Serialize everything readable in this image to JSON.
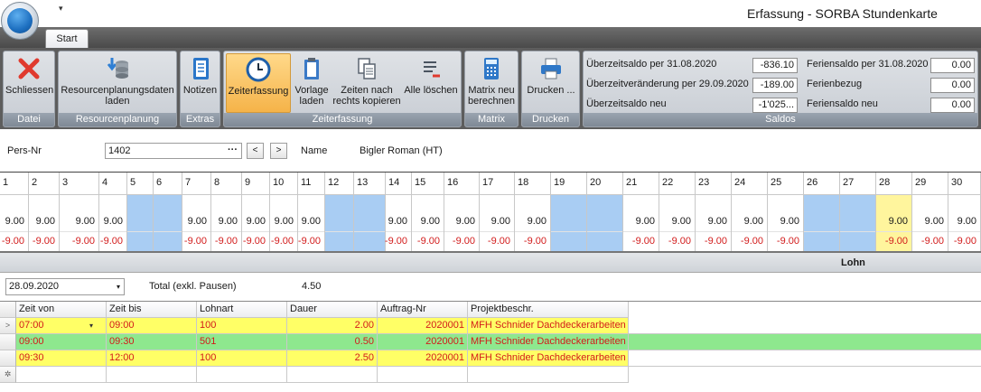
{
  "window": {
    "title": "Erfassung - SORBA Stundenkarte",
    "qat_glyph": "▾"
  },
  "tabs": [
    {
      "label": "Start"
    }
  ],
  "ribbon": {
    "groups": [
      {
        "label": "Datei",
        "buttons": [
          {
            "label": "Schliessen",
            "icon": "close-icon"
          }
        ]
      },
      {
        "label": "Resourcenplanung",
        "buttons": [
          {
            "label": "Resourcenplanungsdaten laden",
            "icon": "database-download-icon"
          }
        ]
      },
      {
        "label": "Extras",
        "buttons": [
          {
            "label": "Notizen",
            "icon": "notebook-icon"
          }
        ]
      },
      {
        "label": "Zeiterfassung",
        "buttons": [
          {
            "label": "Zeiterfassung",
            "icon": "clock-icon"
          },
          {
            "label": "Vorlage laden",
            "icon": "clipboard-icon"
          },
          {
            "label": "Zeiten nach rechts kopieren",
            "icon": "copy-icon"
          },
          {
            "label": "Alle löschen",
            "icon": "delete-list-icon"
          }
        ]
      },
      {
        "label": "Matrix",
        "buttons": [
          {
            "label": "Matrix neu berechnen",
            "icon": "calculator-icon"
          }
        ]
      },
      {
        "label": "Drucken",
        "buttons": [
          {
            "label": "Drucken ...",
            "icon": "printer-icon"
          }
        ]
      }
    ],
    "saldos": {
      "label": "Saldos",
      "rows": [
        {
          "label": "Überzeitsaldo per 31.08.2020",
          "value": "-836.10"
        },
        {
          "label": "Überzeitveränderung per 29.09.2020",
          "value": "-189.00"
        },
        {
          "label": "Überzeitsaldo neu",
          "value": "-1'025..."
        }
      ],
      "ferien": [
        {
          "label": "Feriensaldo per 31.08.2020",
          "value": "0.00"
        },
        {
          "label": "Ferienbezug",
          "value": "0.00"
        },
        {
          "label": "Feriensaldo neu",
          "value": "0.00"
        }
      ]
    }
  },
  "person": {
    "pers_nr_label": "Pers-Nr",
    "pers_nr_value": "1402",
    "lookup_glyph": "···",
    "prev_glyph": "<",
    "next_glyph": ">",
    "name_label": "Name",
    "name_value": "Bigler Roman (HT)"
  },
  "calendar": {
    "days": [
      {
        "day": "1",
        "soll": "9.00",
        "diff": "-9.00"
      },
      {
        "day": "2",
        "soll": "9.00",
        "diff": "-9.00"
      },
      {
        "day": "3",
        "soll": "9.00",
        "diff": "-9.00"
      },
      {
        "day": "4",
        "soll": "9.00",
        "diff": "-9.00"
      },
      {
        "day": "5",
        "soll": "",
        "diff": "",
        "weekend": true
      },
      {
        "day": "6",
        "soll": "",
        "diff": "",
        "weekend": true
      },
      {
        "day": "7",
        "soll": "9.00",
        "diff": "-9.00"
      },
      {
        "day": "8",
        "soll": "9.00",
        "diff": "-9.00"
      },
      {
        "day": "9",
        "soll": "9.00",
        "diff": "-9.00"
      },
      {
        "day": "10",
        "soll": "9.00",
        "diff": "-9.00"
      },
      {
        "day": "11",
        "soll": "9.00",
        "diff": "-9.00"
      },
      {
        "day": "12",
        "soll": "",
        "diff": "",
        "weekend": true
      },
      {
        "day": "13",
        "soll": "",
        "diff": "",
        "weekend": true
      },
      {
        "day": "14",
        "soll": "9.00",
        "diff": "-9.00"
      },
      {
        "day": "15",
        "soll": "9.00",
        "diff": "-9.00"
      },
      {
        "day": "16",
        "soll": "9.00",
        "diff": "-9.00"
      },
      {
        "day": "17",
        "soll": "9.00",
        "diff": "-9.00"
      },
      {
        "day": "18",
        "soll": "9.00",
        "diff": "-9.00"
      },
      {
        "day": "19",
        "soll": "",
        "diff": "",
        "weekend": true
      },
      {
        "day": "20",
        "soll": "",
        "diff": "",
        "weekend": true
      },
      {
        "day": "21",
        "soll": "9.00",
        "diff": "-9.00"
      },
      {
        "day": "22",
        "soll": "9.00",
        "diff": "-9.00"
      },
      {
        "day": "23",
        "soll": "9.00",
        "diff": "-9.00"
      },
      {
        "day": "24",
        "soll": "9.00",
        "diff": "-9.00"
      },
      {
        "day": "25",
        "soll": "9.00",
        "diff": "-9.00"
      },
      {
        "day": "26",
        "soll": "",
        "diff": "",
        "weekend": true
      },
      {
        "day": "27",
        "soll": "",
        "diff": "",
        "weekend": true
      },
      {
        "day": "28",
        "soll": "9.00",
        "diff": "-9.00",
        "today": true
      },
      {
        "day": "29",
        "soll": "9.00",
        "diff": "-9.00"
      },
      {
        "day": "30",
        "soll": "9.00",
        "diff": "-9.00"
      }
    ]
  },
  "lohn": {
    "label": "Lohn"
  },
  "entry": {
    "date": "28.09.2020",
    "date_arrow": "▾",
    "total_label": "Total (exkl. Pausen)",
    "total_value": "4.50"
  },
  "grid": {
    "columns": [
      "Zeit von",
      "Zeit bis",
      "Lohnart",
      "Dauer",
      "Auftrag-Nr",
      "Projektbeschr."
    ],
    "row_indicator_current": ">",
    "row_indicator_new": "✲",
    "edit_arrow": "▾",
    "rows": [
      {
        "von": "07:00",
        "bis": "09:00",
        "lohnart": "100",
        "dauer": "2.00",
        "auftrag": "2020001",
        "projekt": "MFH Schnider Dachdeckerarbeiten",
        "color": "yellow"
      },
      {
        "von": "09:00",
        "bis": "09:30",
        "lohnart": "501",
        "dauer": "0.50",
        "auftrag": "2020001",
        "projekt": "MFH Schnider Dachdeckerarbeiten",
        "color": "green"
      },
      {
        "von": "09:30",
        "bis": "12:00",
        "lohnart": "100",
        "dauer": "2.50",
        "auftrag": "2020001",
        "projekt": "MFH Schnider Dachdeckerarbeiten",
        "color": "yellow"
      }
    ]
  },
  "colors": {
    "weekend": "#a9cdf3",
    "today": "#fff59d",
    "negative": "#d21c1c",
    "row_yellow": "#ffff66",
    "row_green": "#8ee88e",
    "active_button": "#f5b349"
  }
}
